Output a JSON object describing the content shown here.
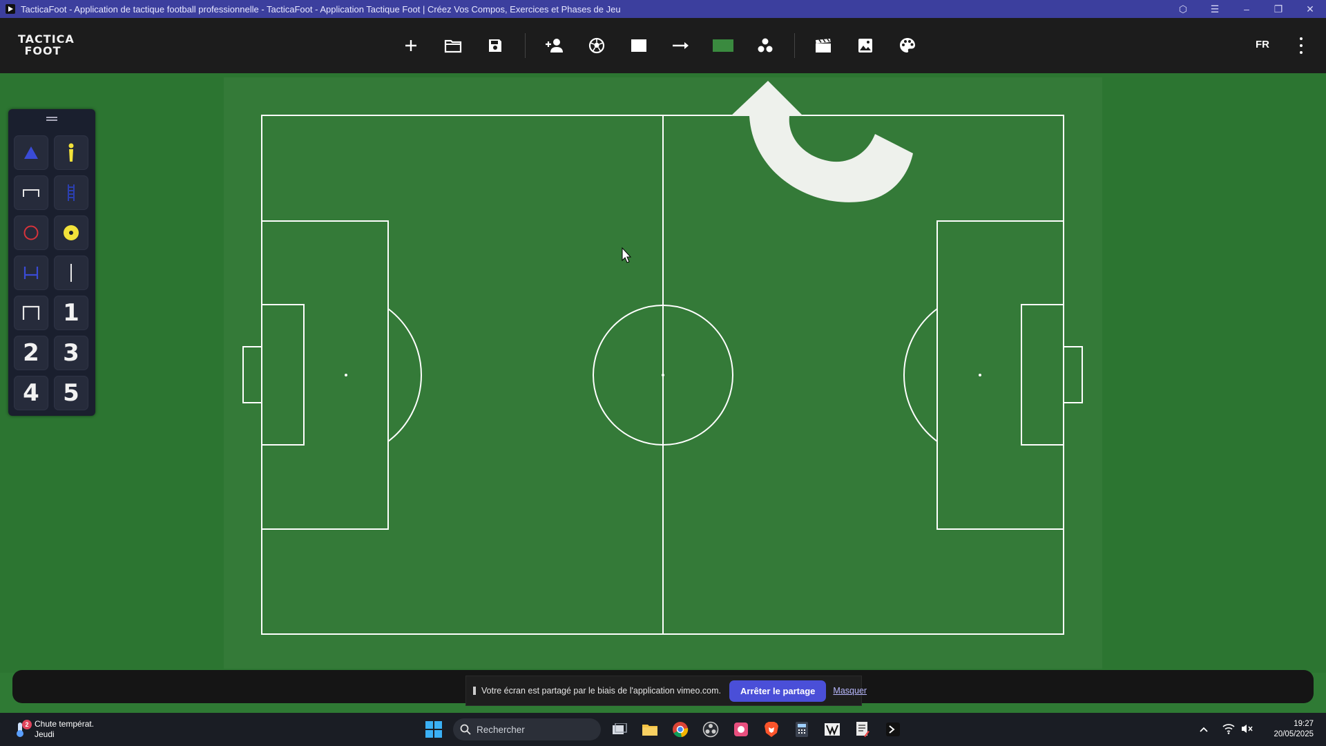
{
  "window": {
    "title": "TacticaFoot - Application de tactique football professionnelle - TacticaFoot - Application Tactique Foot | Créez Vos Compos, Exercices et Phases de Jeu"
  },
  "app": {
    "logo_line1": "TACTICA",
    "logo_line2": "FOOT",
    "language": "FR",
    "accent_color": "#4a4fd8",
    "field_color": "#347a38"
  },
  "toolbar": {
    "icons": [
      "plus-icon",
      "folder-open-icon",
      "save-icon",
      "add-player-icon",
      "ball-icon",
      "rectangle-icon",
      "arrow-right-icon",
      "field-color-swatch",
      "group-icon",
      "clapperboard-icon",
      "image-icon",
      "palette-icon"
    ],
    "swatch_color": "#3a8a3f"
  },
  "palette": {
    "numbers": [
      "1",
      "2",
      "3",
      "4",
      "5"
    ],
    "tools": [
      "cone-icon",
      "player-figure-icon",
      "hurdle-icon",
      "ladder-icon",
      "ring-icon",
      "ball-marker-icon",
      "h-goal-icon",
      "pole-icon",
      "mini-goal-icon"
    ]
  },
  "share": {
    "message": "Votre écran est partagé par le biais de l'application vimeo.com.",
    "stop_label": "Arrêter le partage",
    "hide_label": "Masquer"
  },
  "taskbar": {
    "weather_title": "Chute températ.",
    "weather_day": "Jeudi",
    "weather_badge": "2",
    "search_placeholder": "Rechercher",
    "time": "19:27",
    "date": "20/05/2025"
  }
}
